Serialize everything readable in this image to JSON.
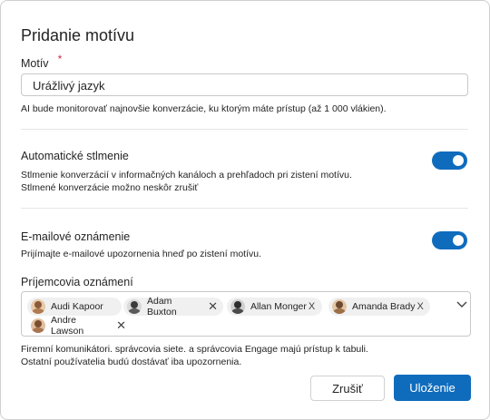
{
  "dialog": {
    "title": "Pridanie motívu",
    "topic_label": "Motív",
    "required_mark": "*",
    "topic_value": "Urážlivý jazyk",
    "topic_hint": "AI bude monitorovať najnovšie konverzácie, ku ktorým máte prístup (až 1 000 vlákien).",
    "auto_mute": {
      "label": "Automatické stlmenie",
      "desc1": "Stlmenie konverzácií v informačných kanáloch a prehľadoch pri zistení motívu.",
      "desc2": "Stlmené konverzácie možno neskôr zrušiť",
      "on": true
    },
    "email_notification": {
      "label": "E-mailové oznámenie",
      "desc": "Prijímajte e-mailové upozornenia hneď po zistení motívu.",
      "on": true
    },
    "recipients_label": "Príjemcovia oznámení",
    "recipients": [
      {
        "name": "Audi Kapoor"
      },
      {
        "name": "Adam Buxton",
        "remove": "✕"
      },
      {
        "name": "Allan Monger",
        "remove": "X"
      },
      {
        "name": "Amanda Brady",
        "remove": "X"
      },
      {
        "name": "Andre Lawson",
        "remove": "✕"
      }
    ],
    "footer_note1": "Firemní komunikátori. správcovia siete. a správcovia Engage majú prístup k tabuli.",
    "footer_note2": "Ostatní používatelia budú dostávať iba upozornenia.",
    "cancel_label": "Zrušiť",
    "save_label": "Uloženie"
  },
  "colors": {
    "accent": "#0f6cbd",
    "required": "#c4314b"
  }
}
